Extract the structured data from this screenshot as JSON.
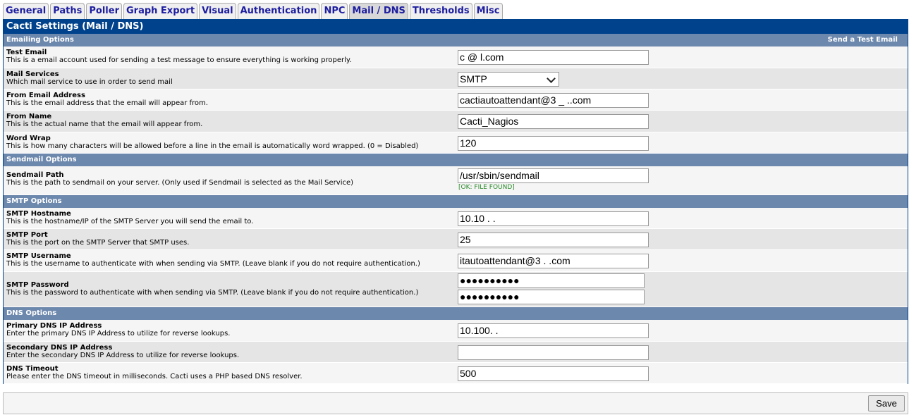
{
  "tabs": [
    "General",
    "Paths",
    "Poller",
    "Graph Export",
    "Visual",
    "Authentication",
    "NPC",
    "Mail / DNS",
    "Thresholds",
    "Misc"
  ],
  "active_tab": "Mail / DNS",
  "title": "Cacti Settings (Mail / DNS)",
  "sections": {
    "emailing": {
      "label": "Emailing Options",
      "action": "Send a Test Email"
    },
    "sendmail": {
      "label": "Sendmail Options"
    },
    "smtp": {
      "label": "SMTP Options"
    },
    "dns": {
      "label": "DNS Options"
    }
  },
  "fields": {
    "test_email": {
      "label": "Test Email",
      "desc": "This is a email account used for sending a test message to ensure everything is working properly.",
      "value": "c          @       l.com"
    },
    "mail_services": {
      "label": "Mail Services",
      "desc": "Which mail service to use in order to send mail",
      "value": "SMTP"
    },
    "from_email": {
      "label": "From Email Address",
      "desc": "This is the email address that the email will appear from.",
      "value": "cactiautoattendant@3    _    ..com"
    },
    "from_name": {
      "label": "From Name",
      "desc": "This is the actual name that the email will appear from.",
      "value": "Cacti_Nagios"
    },
    "word_wrap": {
      "label": "Word Wrap",
      "desc": "This is how many characters will be allowed before a line in the email is automatically word wrapped. (0 = Disabled)",
      "value": "120"
    },
    "sendmail_path": {
      "label": "Sendmail Path",
      "desc": "This is the path to sendmail on your server. (Only used if Sendmail is selected as the Mail Service)",
      "value": "/usr/sbin/sendmail",
      "status": "[OK: FILE FOUND]"
    },
    "smtp_host": {
      "label": "SMTP Hostname",
      "desc": "This is the hostname/IP of the SMTP Server you will send the email to.",
      "value": "10.10 .  ."
    },
    "smtp_port": {
      "label": "SMTP Port",
      "desc": "This is the port on the SMTP Server that SMTP uses.",
      "value": "25"
    },
    "smtp_user": {
      "label": "SMTP Username",
      "desc": "This is the username to authenticate with when sending via SMTP. (Leave blank if you do not require authentication.)",
      "value": "itautoattendant@3     .  .com"
    },
    "smtp_pass": {
      "label": "SMTP Password",
      "desc": "This is the password to authenticate with when sending via SMTP. (Leave blank if you do not require authentication.)",
      "value": "●●●●●●●●●●",
      "confirm": "●●●●●●●●●●"
    },
    "dns_primary": {
      "label": "Primary DNS IP Address",
      "desc": "Enter the primary DNS IP Address to utilize for reverse lookups.",
      "value": "10.100.  .  "
    },
    "dns_secondary": {
      "label": "Secondary DNS IP Address",
      "desc": "Enter the secondary DNS IP Address to utilize for reverse lookups.",
      "value": ""
    },
    "dns_timeout": {
      "label": "DNS Timeout",
      "desc": "Please enter the DNS timeout in milliseconds. Cacti uses a PHP based DNS resolver.",
      "value": "500"
    }
  },
  "save_label": "Save"
}
